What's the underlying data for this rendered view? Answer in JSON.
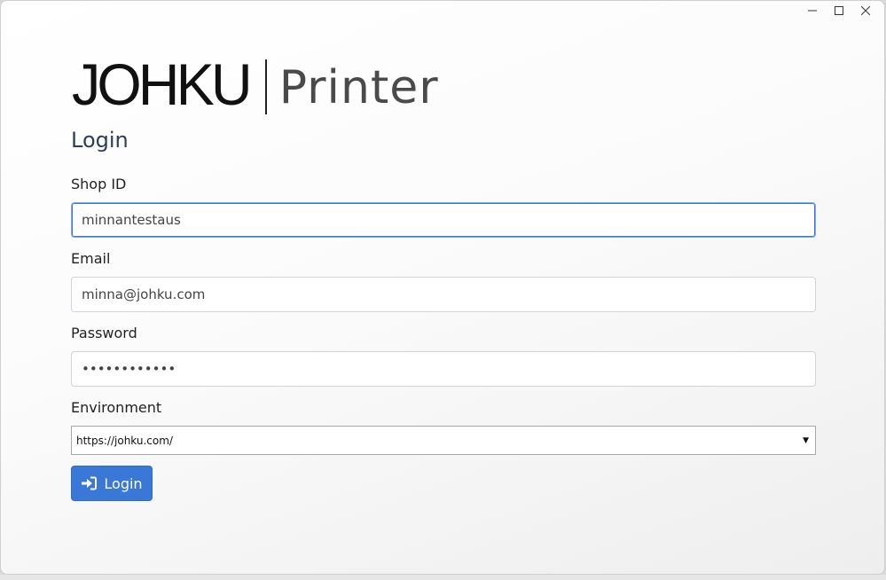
{
  "window": {
    "minimize_icon": "minimize-icon",
    "maximize_icon": "maximize-icon",
    "close_icon": "close-icon"
  },
  "logo": {
    "brand": "JOHKU",
    "product": "Printer"
  },
  "page": {
    "title": "Login"
  },
  "form": {
    "shop_id_label": "Shop ID",
    "shop_id_value": "minnantestaus",
    "email_label": "Email",
    "email_value": "minna@johku.com",
    "password_label": "Password",
    "password_value": "••••••••••••",
    "environment_label": "Environment",
    "environment_value": "https://johku.com/",
    "login_label": "Login",
    "login_icon": "sign-in-icon"
  },
  "colors": {
    "accent": "#3a78d8",
    "title": "#2f3e58"
  }
}
